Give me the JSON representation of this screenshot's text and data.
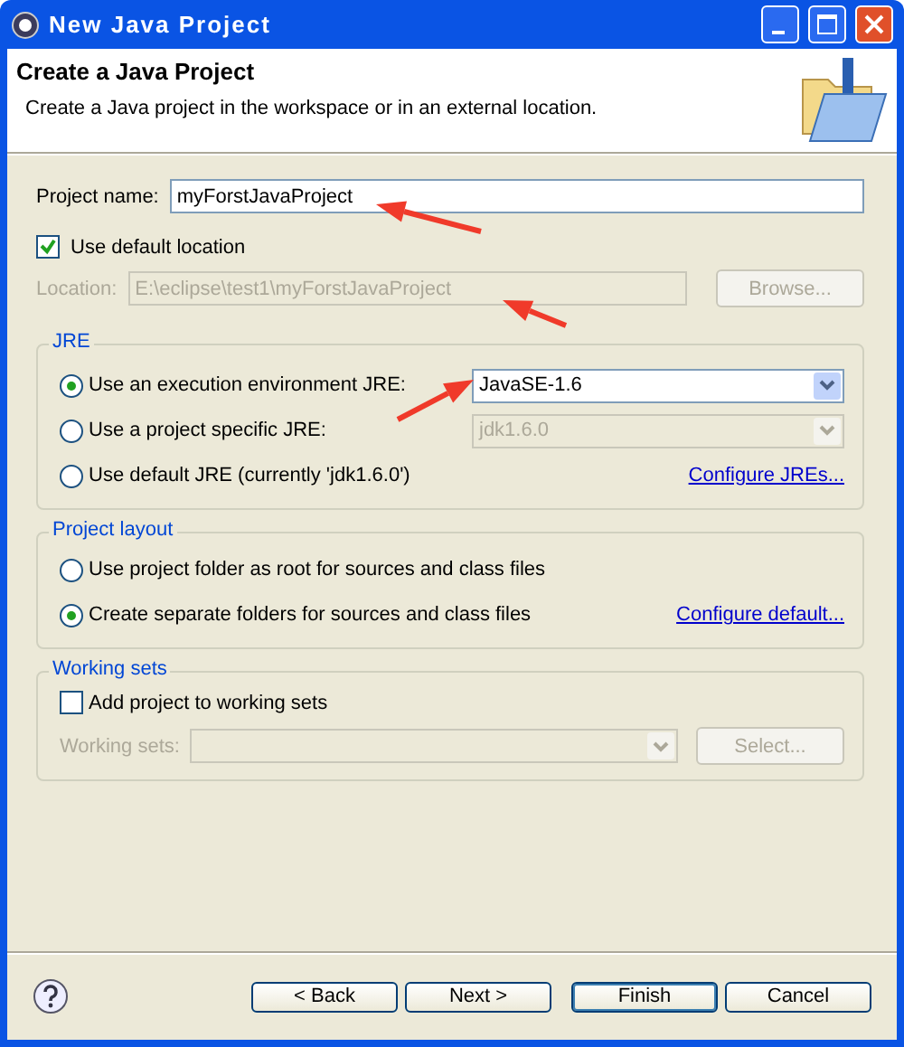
{
  "window": {
    "title": "New Java Project"
  },
  "header": {
    "title": "Create a Java Project",
    "description": "Create a Java project in the workspace or in an external location."
  },
  "project_name": {
    "label": "Project name:",
    "value": "myForstJavaProject"
  },
  "default_location": {
    "label": "Use default location",
    "checked": true
  },
  "location": {
    "label": "Location:",
    "value": "E:\\eclipse\\test1\\myForstJavaProject",
    "disabled": true,
    "button": "Browse..."
  },
  "jre": {
    "title": "JRE",
    "options": [
      {
        "label": "Use an execution environment JRE:",
        "selected": true,
        "combo": "JavaSE-1.6",
        "disabled": false
      },
      {
        "label": "Use a project specific JRE:",
        "selected": false,
        "combo": "jdk1.6.0",
        "disabled": true
      },
      {
        "label": "Use default JRE (currently 'jdk1.6.0')",
        "selected": false,
        "link": "Configure JREs..."
      }
    ]
  },
  "project_layout": {
    "title": "Project layout",
    "options": [
      {
        "label": "Use project folder as root for sources and class files",
        "selected": false
      },
      {
        "label": "Create separate folders for sources and class files",
        "selected": true,
        "link": "Configure default..."
      }
    ]
  },
  "working_sets": {
    "title": "Working sets",
    "add": {
      "label": "Add project to working sets",
      "checked": false
    },
    "label": "Working sets:",
    "disabled": true,
    "button": "Select..."
  },
  "buttons": [
    {
      "label": "< Back",
      "default": false
    },
    {
      "label": "Next >",
      "default": false
    },
    {
      "label": "Finish",
      "default": true
    },
    {
      "label": "Cancel",
      "default": false
    }
  ]
}
